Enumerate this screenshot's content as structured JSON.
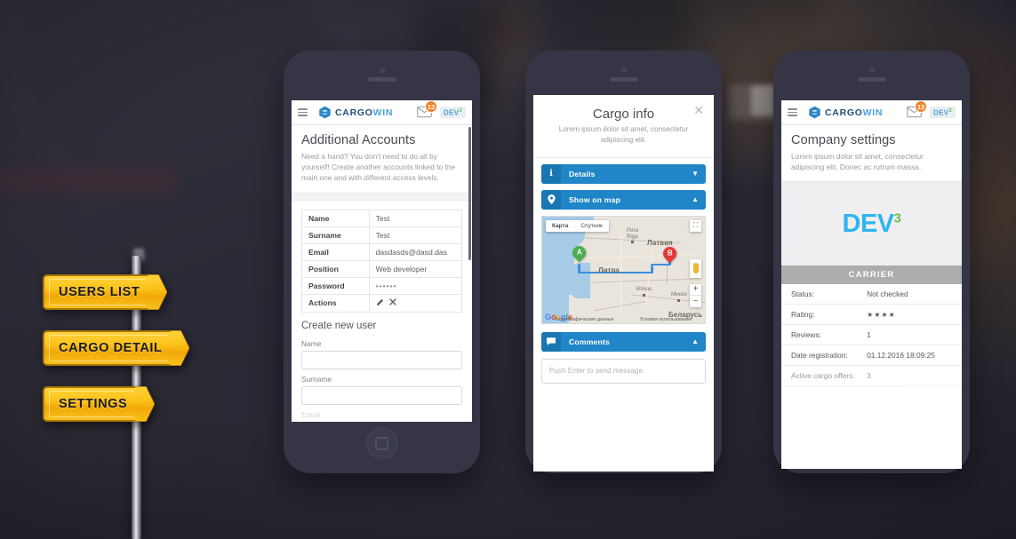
{
  "theme": {
    "accent_blue": "#2086c8",
    "sign_yellow": "#fbc117",
    "badge_orange": "#f0842a",
    "dev_blue": "#2fb5ee",
    "dev_green": "#6cc04a"
  },
  "signpost": {
    "signs": [
      {
        "label": "USERS LIST"
      },
      {
        "label": "CARGO DETAIL"
      },
      {
        "label": "SETTINGS"
      }
    ]
  },
  "navbar": {
    "menu_icon": "hamburger-icon",
    "brand_part1": "CARGO",
    "brand_part2": "WIN",
    "mail_icon": "mail-icon",
    "mail_badge": "13",
    "dev_chip": "DEV",
    "dev_chip_sup": "3"
  },
  "phone1": {
    "title": "Additional Accounts",
    "subtitle": "Need a hand? You don't need to do all by yourself! Create another accounts linked to the main one and with different access levels.",
    "table": [
      {
        "key": "Name",
        "value": "Test"
      },
      {
        "key": "Surname",
        "value": "Test"
      },
      {
        "key": "Email",
        "value": "dasdasds@dasd.das"
      },
      {
        "key": "Position",
        "value": "Web developer"
      },
      {
        "key": "Password",
        "value": "••••••"
      },
      {
        "key": "Actions",
        "value": ""
      }
    ],
    "actions": {
      "edit_icon": "pencil-icon",
      "delete_icon": "cross-icon"
    },
    "form_title": "Create new user",
    "fields": [
      {
        "label": "Name",
        "value": ""
      },
      {
        "label": "Surname",
        "value": ""
      },
      {
        "label": "Email",
        "value": ""
      }
    ]
  },
  "phone2": {
    "title": "Cargo info",
    "subtitle": "Lorem ipsum dolor sit amet, consectetur adipiscing elit.",
    "close_icon": "close-icon",
    "accordions": [
      {
        "label": "Details",
        "icon": "info-icon",
        "state": "collapsed",
        "caret": "▼"
      },
      {
        "label": "Show on map",
        "icon": "map-pin-icon",
        "state": "expanded",
        "caret": "▲"
      },
      {
        "label": "Comments",
        "icon": "comment-icon",
        "state": "expanded",
        "caret": "▲"
      }
    ],
    "map": {
      "type_map": "Карта",
      "type_satellite": "Спутник",
      "countries": [
        "Латвия",
        "Литва",
        "Беларусь"
      ],
      "cities": [
        {
          "name": "Рига",
          "name2": "Riga"
        },
        {
          "name": "Vilnius"
        },
        {
          "name": "Минск"
        }
      ],
      "pin_a": "A",
      "pin_b": "B",
      "attribution_left": "Картографические данные",
      "attribution_right": "Условия использования",
      "google_letters": [
        "G",
        "o",
        "o",
        "g",
        "l",
        "e"
      ],
      "fullscreen_icon": "fullscreen-icon",
      "pegman_icon": "pegman-icon",
      "zoom_in": "+",
      "zoom_out": "−"
    },
    "comment_placeholder": "Push Enter to send message"
  },
  "phone3": {
    "title": "Company settings",
    "subtitle": "Lorem ipsum dolor sit amet, consectetur adipiscing elit. Donec ac rutrum massa.",
    "logo_text": "DEV",
    "logo_sup": "3",
    "carrier_label": "CARRIER",
    "rows": [
      {
        "key": "Status:",
        "value": "Not checked"
      },
      {
        "key": "Rating:",
        "value": "★★★★"
      },
      {
        "key": "Reviews:",
        "value": "1"
      },
      {
        "key": "Date registration:",
        "value": "01.12.2016 18:09:25"
      },
      {
        "key": "Active cargo offers:",
        "value": "3"
      }
    ]
  }
}
